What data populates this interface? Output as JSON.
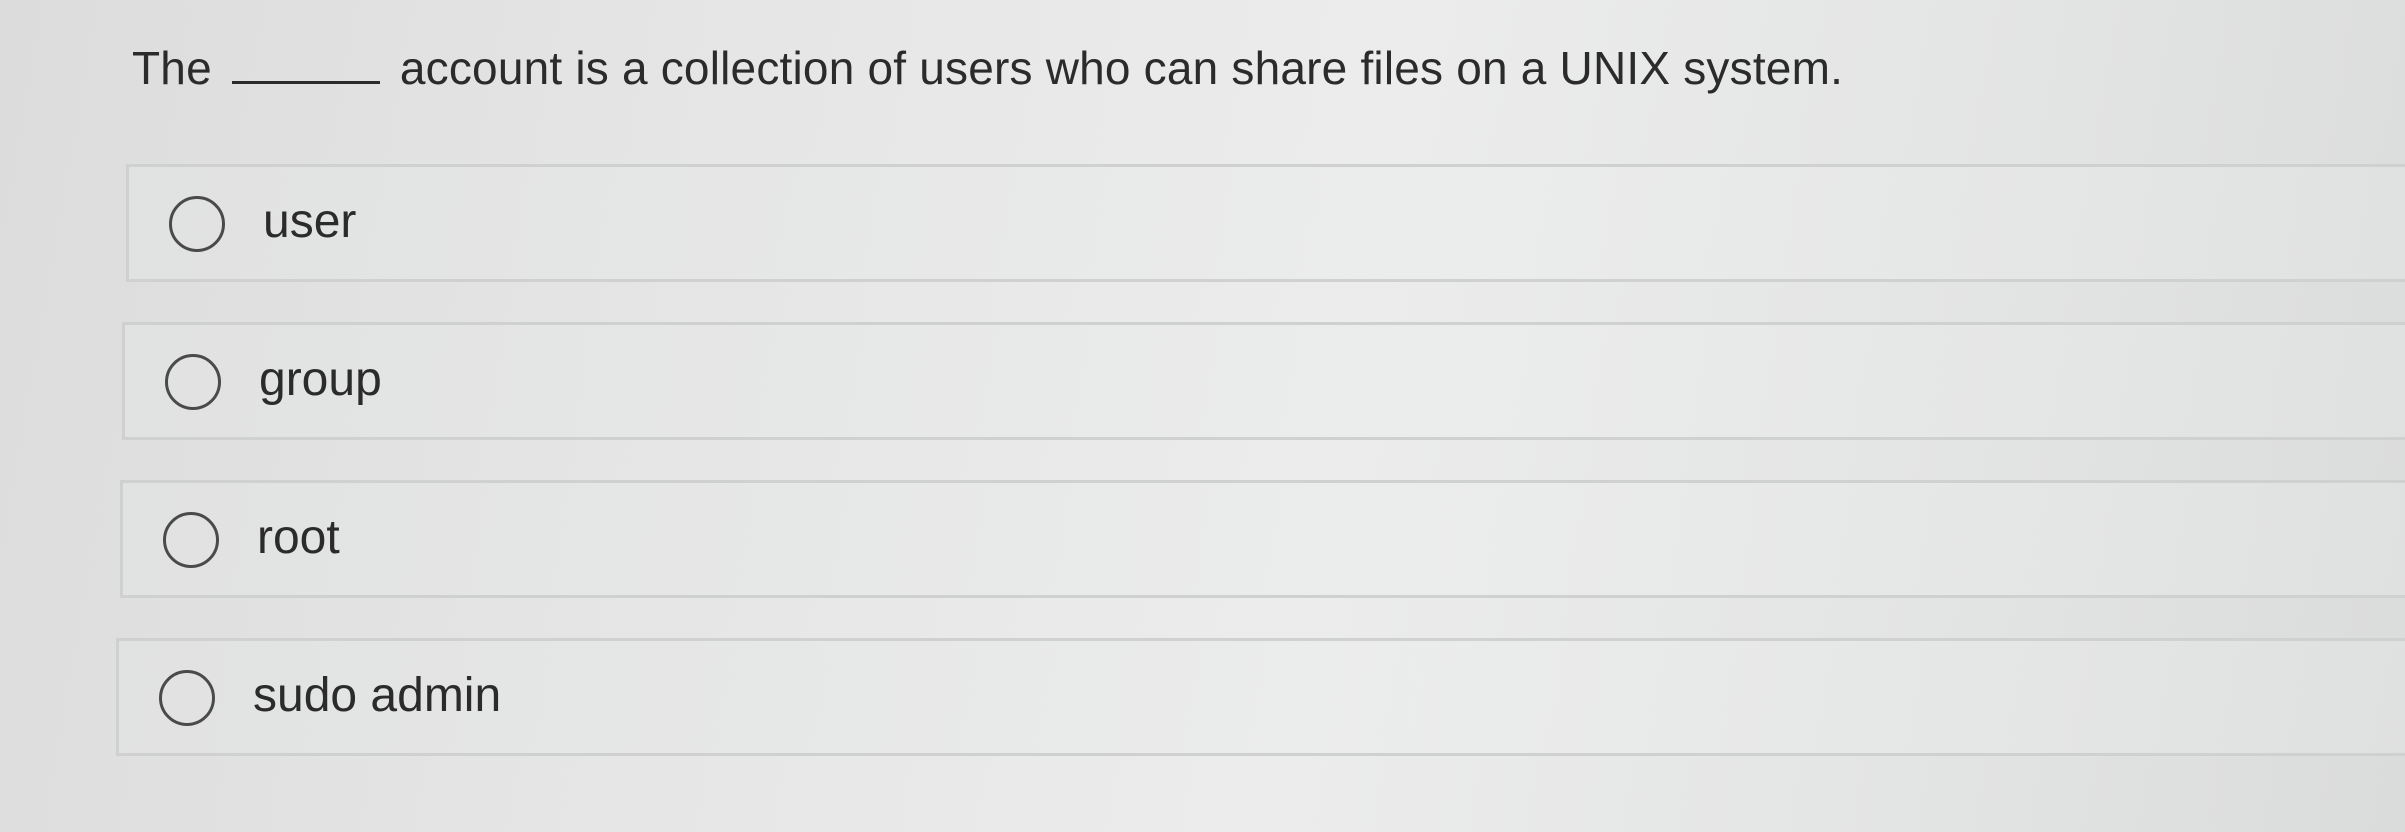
{
  "question": {
    "before_blank": "The",
    "after_blank": "account is a collection of users who can share files on a UNIX system."
  },
  "options": [
    {
      "label": "user",
      "selected": false
    },
    {
      "label": "group",
      "selected": false
    },
    {
      "label": "root",
      "selected": false
    },
    {
      "label": "sudo admin",
      "selected": false
    }
  ]
}
